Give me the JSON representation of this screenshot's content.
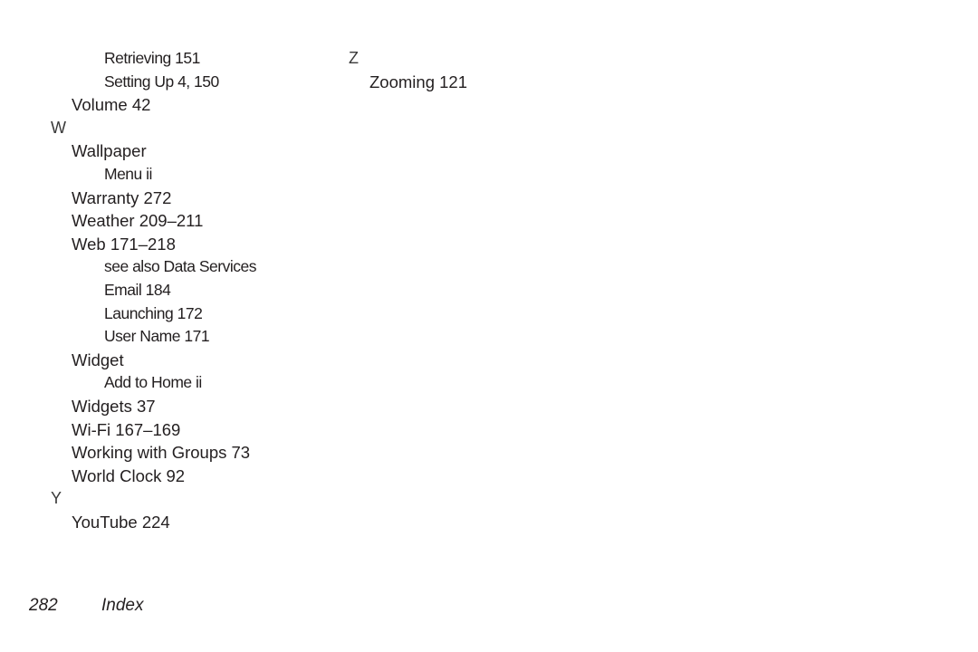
{
  "columns": [
    {
      "entries": [
        {
          "level": 2,
          "text": "Retrieving 151"
        },
        {
          "level": 2,
          "text": "Setting Up 4, 150"
        },
        {
          "level": 1,
          "text": "Volume 42"
        },
        {
          "level": 0,
          "text": "W"
        },
        {
          "level": 1,
          "text": "Wallpaper"
        },
        {
          "level": 2,
          "text": "Menu ii"
        },
        {
          "level": 1,
          "text": "Warranty 272"
        },
        {
          "level": 1,
          "text": "Weather 209–211"
        },
        {
          "level": 1,
          "text": "Web 171–218"
        },
        {
          "level": 2,
          "text": "see also Data Services"
        },
        {
          "level": 2,
          "text": "Email 184"
        },
        {
          "level": 2,
          "text": "Launching 172"
        },
        {
          "level": 2,
          "text": "User Name 171"
        },
        {
          "level": 1,
          "text": "Widget"
        },
        {
          "level": 2,
          "text": "Add to Home ii"
        },
        {
          "level": 1,
          "text": "Widgets 37"
        },
        {
          "level": 1,
          "text": "Wi-Fi 167–169"
        },
        {
          "level": 1,
          "text": "Working with Groups 73"
        },
        {
          "level": 1,
          "text": "World Clock 92"
        },
        {
          "level": 0,
          "text": "Y"
        },
        {
          "level": 1,
          "text": "YouTube 224"
        }
      ]
    },
    {
      "entries": [
        {
          "level": 0,
          "text": "Z"
        },
        {
          "level": 1,
          "text": "Zooming 121"
        }
      ]
    }
  ],
  "footer": {
    "page_number": "282",
    "section": "Index"
  }
}
